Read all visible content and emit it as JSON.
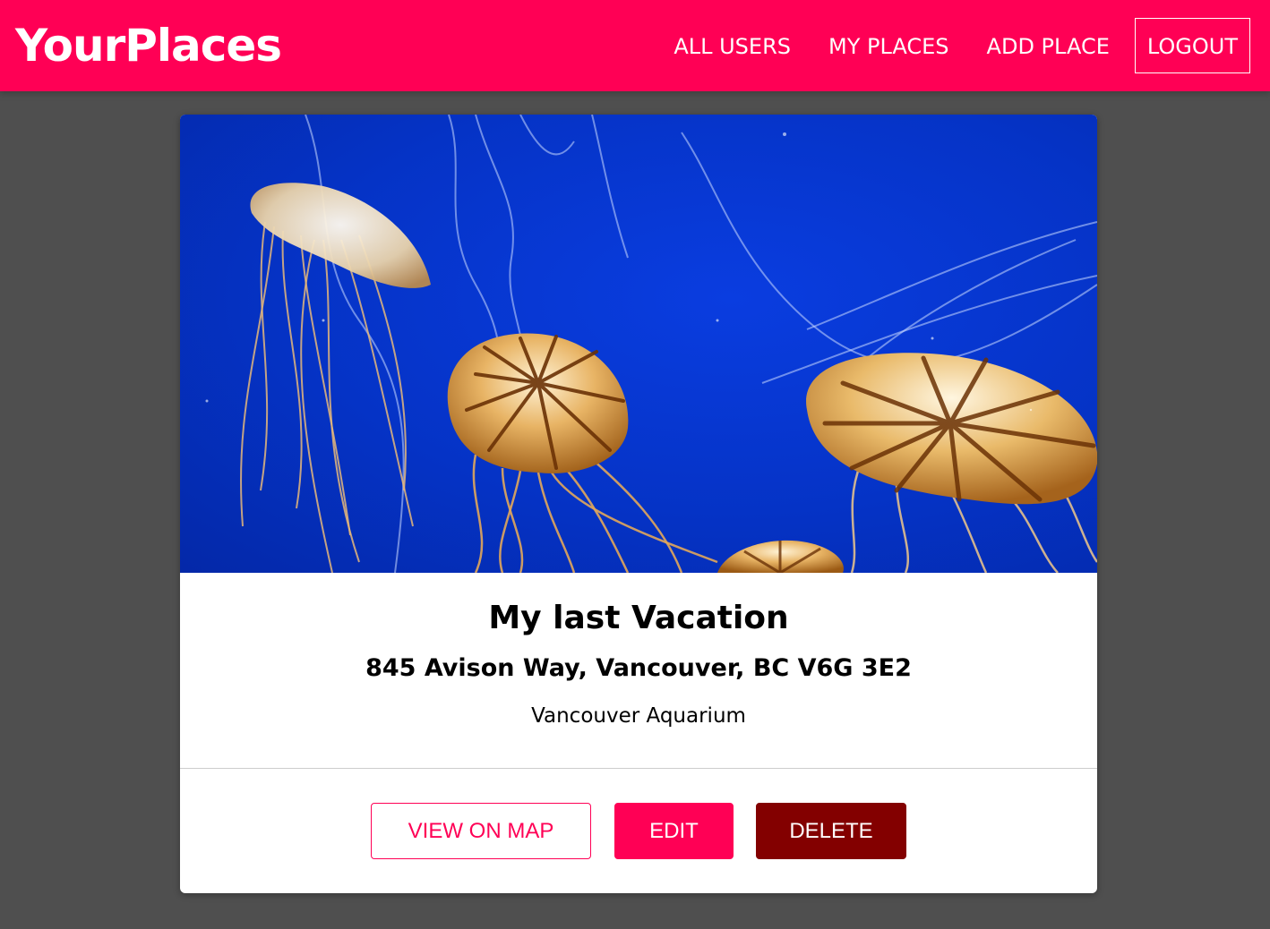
{
  "header": {
    "brand": "YourPlaces",
    "nav": [
      {
        "label": "ALL USERS"
      },
      {
        "label": "MY PLACES"
      },
      {
        "label": "ADD PLACE"
      },
      {
        "label": "LOGOUT"
      }
    ]
  },
  "place": {
    "image_subject": "jellyfish-photo",
    "title": "My last Vacation",
    "address": "845 Avison Way, Vancouver, BC V6G 3E2",
    "description": "Vancouver Aquarium"
  },
  "actions": {
    "view_on_map": "VIEW ON MAP",
    "edit": "EDIT",
    "delete": "DELETE"
  },
  "colors": {
    "brand": "#ff0055",
    "danger": "#830000",
    "page_background": "#4f4f4f"
  }
}
